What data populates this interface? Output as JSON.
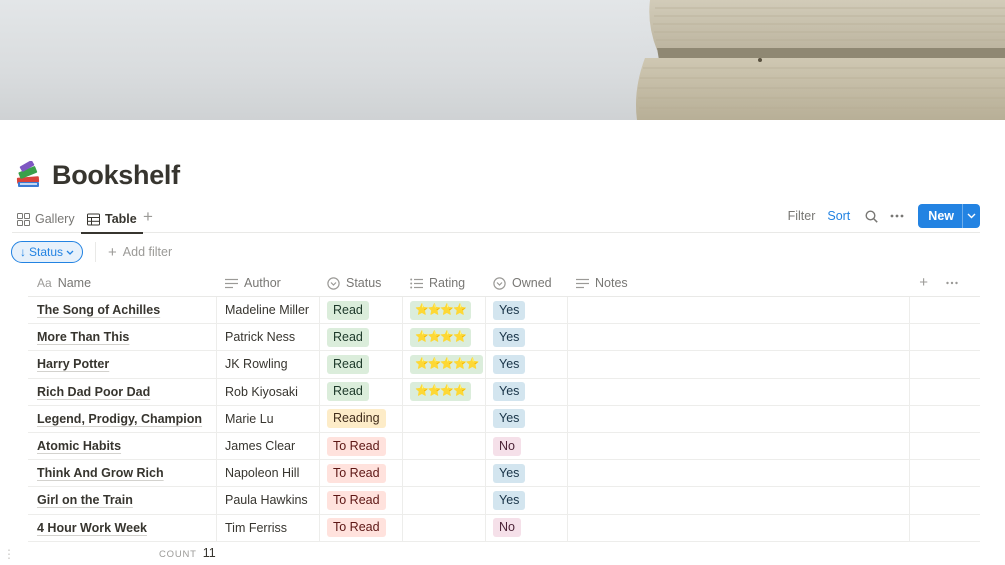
{
  "page": {
    "title": "Bookshelf",
    "icon": "books-emoji-icon"
  },
  "views": {
    "tabs": [
      {
        "label": "Gallery",
        "icon": "grid-icon"
      },
      {
        "label": "Table",
        "icon": "table-icon",
        "active": true
      }
    ]
  },
  "toolbar": {
    "filter": "Filter",
    "sort": "Sort",
    "new": "New"
  },
  "filters": {
    "status_chip": "Status",
    "add_filter": "Add filter"
  },
  "columns": {
    "name": "Name",
    "name_prefix": "Aa",
    "author": "Author",
    "status": "Status",
    "rating": "Rating",
    "owned": "Owned",
    "notes": "Notes"
  },
  "rows": [
    {
      "name": "The Song of Achilles",
      "author": "Madeline Miller",
      "status": "Read",
      "rating": "⭐⭐⭐⭐",
      "owned": "Yes"
    },
    {
      "name": "More Than This",
      "author": "Patrick Ness",
      "status": "Read",
      "rating": "⭐⭐⭐⭐",
      "owned": "Yes"
    },
    {
      "name": "Harry Potter",
      "author": "JK Rowling",
      "status": "Read",
      "rating": "⭐⭐⭐⭐⭐",
      "owned": "Yes"
    },
    {
      "name": "Rich Dad Poor Dad",
      "author": "Rob Kiyosaki",
      "status": "Read",
      "rating": "⭐⭐⭐⭐",
      "owned": "Yes"
    },
    {
      "name": "Legend, Prodigy, Champion",
      "author": "Marie Lu",
      "status": "Reading",
      "rating": "",
      "owned": "Yes"
    },
    {
      "name": "Atomic Habits",
      "author": "James Clear",
      "status": "To Read",
      "rating": "",
      "owned": "No"
    },
    {
      "name": "Think And Grow Rich",
      "author": "Napoleon Hill",
      "status": "To Read",
      "rating": "",
      "owned": "Yes"
    },
    {
      "name": "Girl on the Train",
      "author": "Paula Hawkins",
      "status": "To Read",
      "rating": "",
      "owned": "Yes"
    },
    {
      "name": "4 Hour Work Week",
      "author": "Tim Ferriss",
      "status": "To Read",
      "rating": "",
      "owned": "No"
    }
  ],
  "footer": {
    "count_label": "COUNT",
    "count_value": "11"
  },
  "colors": {
    "accent": "#2383e2",
    "tag_read": "#dbeddb",
    "tag_reading": "#fdecc8",
    "tag_to_read": "#ffe2dd",
    "tag_yes": "#d3e5ef",
    "tag_no": "#f5e0e9"
  }
}
